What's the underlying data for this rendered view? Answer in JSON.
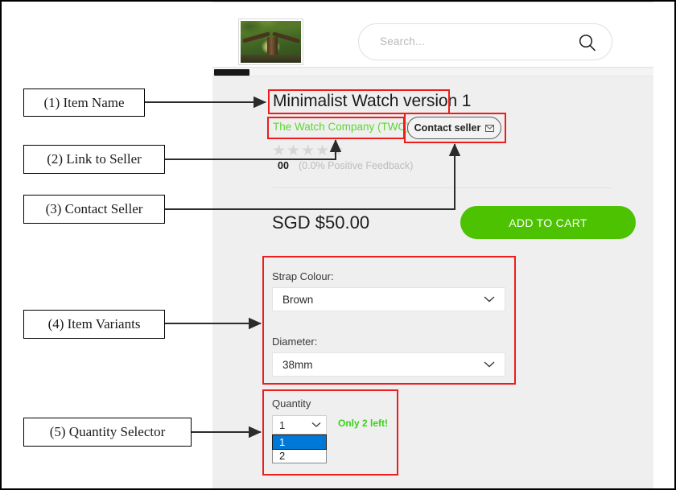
{
  "header": {
    "logo_icon": "forest-tree-logo-image",
    "search": {
      "placeholder": "Search...",
      "value": "",
      "icon": "search-icon"
    }
  },
  "product": {
    "title": "Minimalist Watch version 1",
    "seller_link": "The Watch Company (TWC)",
    "contact_seller_label": "Contact seller",
    "contact_seller_icon": "envelope-icon",
    "stars": 5,
    "star_glyph": "★",
    "rating_count": "00",
    "feedback": "(0.0% Positive Feedback)",
    "price": "SGD $50.00",
    "add_to_cart_label": "ADD TO CART",
    "variants": [
      {
        "label": "Strap Colour:",
        "value": "Brown",
        "options": [
          "Brown"
        ]
      },
      {
        "label": "Diameter:",
        "value": "38mm",
        "options": [
          "38mm"
        ]
      }
    ],
    "quantity": {
      "label": "Quantity",
      "value": "1",
      "options": [
        "1",
        "2"
      ],
      "selected_option": "1",
      "stock_note": "Only 2 left!"
    }
  },
  "annotations": [
    {
      "id": 1,
      "text": "(1) Item  Name"
    },
    {
      "id": 2,
      "text": "(2) Link  to Seller"
    },
    {
      "id": 3,
      "text": "(3) Contact Seller"
    },
    {
      "id": 4,
      "text": "(4) Item  Variants"
    },
    {
      "id": 5,
      "text": "(5) Quantity  Selector"
    }
  ],
  "colors": {
    "accent_green": "#4cc200",
    "seller_link_green": "#5fd633",
    "stock_note_green": "#38d316",
    "annotation_red": "#ee1c1c",
    "dropdown_highlight_blue": "#0078d7",
    "page_bg": "#efefef"
  }
}
